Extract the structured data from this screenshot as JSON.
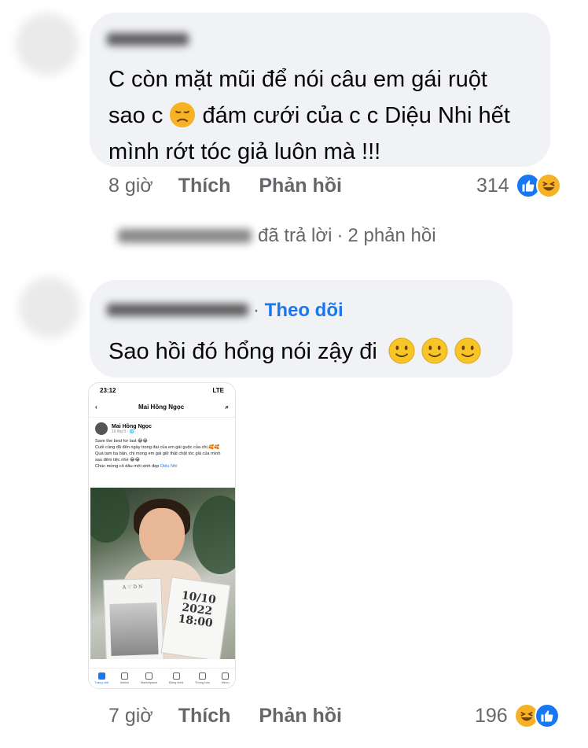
{
  "comments": [
    {
      "text_lines": [
        "C còn mặt mũi để nói câu em gái ruột",
        "sao c",
        "đám cưới của c c Diệu Nhi hết",
        "mình rớt tóc giả luôn mà !!!"
      ],
      "inline_emoji": "disappointed-face",
      "time": "8 giờ",
      "like_label": "Thích",
      "reply_label": "Phản hồi",
      "reaction_count": "314",
      "reaction_icons": [
        "like-icon",
        "haha-icon"
      ]
    },
    {
      "follow_label": "Theo dõi",
      "text": "Sao hồi đó hổng nói zậy đi",
      "trailing_emoji": [
        "slightly-smiling-face",
        "slightly-smiling-face",
        "slightly-smiling-face"
      ],
      "time": "7 giờ",
      "like_label": "Thích",
      "reply_label": "Phản hồi",
      "reaction_count": "196",
      "reaction_icons": [
        "haha-icon",
        "like-icon"
      ]
    }
  ],
  "reply_summary": {
    "text": "đã trả lời",
    "separator": "·",
    "count_text": "2 phản hồi"
  },
  "attachment": {
    "status_time": "23:12",
    "status_right": "LTE",
    "header_title": "Mai Hồng Ngọc",
    "post_author": "Mai Hồng Ngọc",
    "post_meta": "16 thg 9 · 🌐",
    "post_lines": [
      "Save the best for last 😂😂",
      "Cuối cùng đã đến ngày trọng đại của em gái guộc của chị 🥰🥰",
      "Quá tam ba bận, chị mong em gái giữ thật chặt tóc giả của mình sau đêm tiệc nhé 😂😂",
      "Chúc mừng cô dâu mới xinh đẹp"
    ],
    "post_link": "Diệu Nhi",
    "card_date": "10/10 2022 18:00",
    "nav_items": [
      "Trang chủ",
      "Watch",
      "Marketplace",
      "Bảng feed",
      "Thông báo",
      "Menu"
    ]
  },
  "colors": {
    "bubble": "#f0f2f5",
    "meta_text": "#65676b",
    "link_blue": "#1877f2",
    "haha_yellow": "#f7b125"
  }
}
